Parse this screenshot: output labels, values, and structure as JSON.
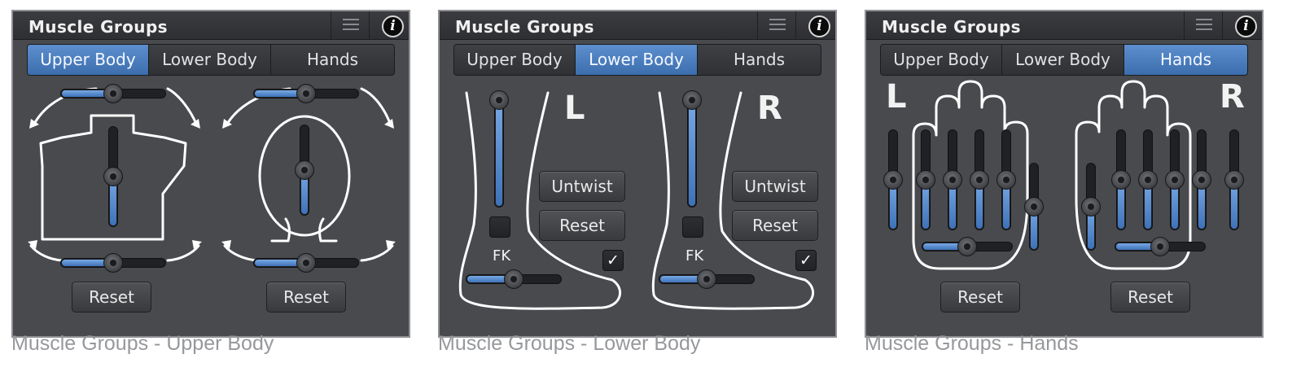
{
  "panel_title": "Muscle Groups",
  "tabs": [
    "Upper Body",
    "Lower Body",
    "Hands"
  ],
  "info_symbol": "i",
  "icons": {
    "menu": "hamburger-icon",
    "info": "info-icon",
    "check": "checkmark-icon"
  },
  "colors": {
    "accent": "#4a7fc2",
    "panel_bg": "#484a4e",
    "caption": "#96989c"
  },
  "panels": [
    {
      "active_tab": "Upper Body",
      "reset_label": "Reset",
      "caption": "Muscle Groups - Upper Body",
      "sliders": {
        "chest_twist": 0.5,
        "chest_bend": 0.5,
        "chest_tilt": 0.5,
        "head_twist": 0.5,
        "head_bend": 0.5,
        "head_tilt": 0.5
      }
    },
    {
      "active_tab": "Lower Body",
      "left_label": "L",
      "right_label": "R",
      "untwist_label": "Untwist",
      "reset_label": "Reset",
      "fk_label": "FK",
      "check_mark": "✓",
      "caption": "Muscle Groups - Lower Body",
      "sliders": {
        "left_leg_stretch": 0.0,
        "left_foot": 0.5,
        "right_leg_stretch": 0.0,
        "right_foot": 0.5
      },
      "checkboxes": {
        "left_upper": false,
        "left_lower": true,
        "right_upper": false,
        "right_lower": true
      }
    },
    {
      "active_tab": "Hands",
      "left_label": "L",
      "right_label": "R",
      "reset_label": "Reset",
      "caption": "Muscle Groups - Hands",
      "sliders": {
        "left_fingers": 0.5,
        "left_thumb": 0.5,
        "left_spread": 0.5,
        "right_fingers": 0.5,
        "right_thumb": 0.5,
        "right_spread": 0.5
      }
    }
  ]
}
